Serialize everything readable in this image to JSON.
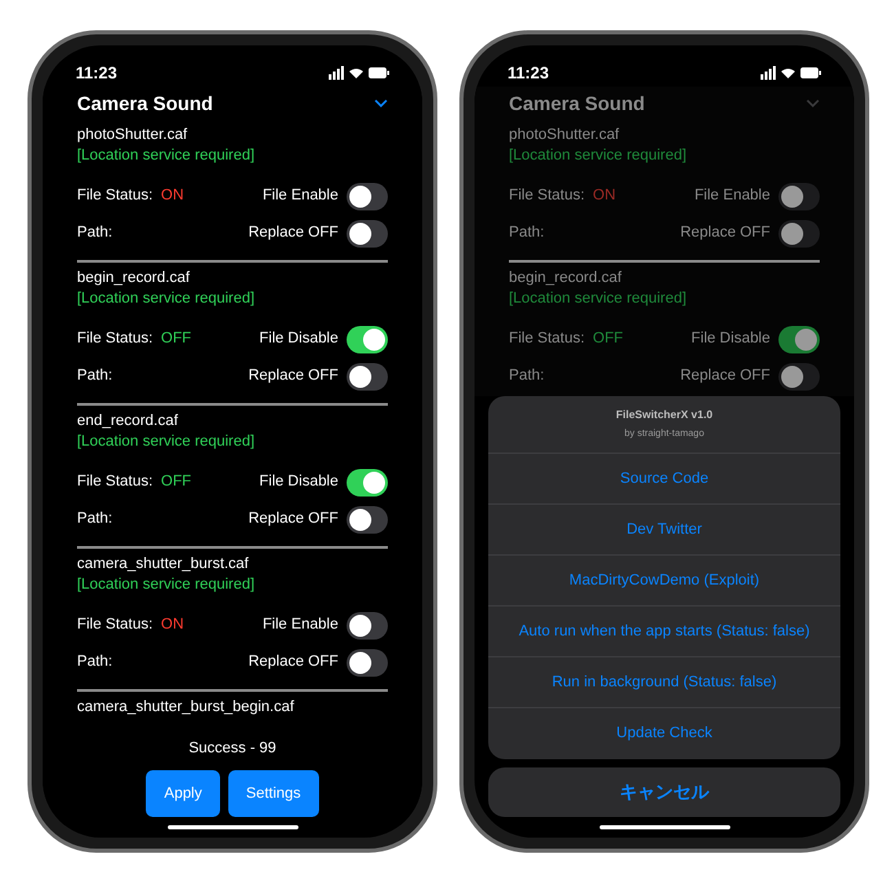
{
  "phones": [
    {
      "time": "11:23",
      "title": "Camera Sound",
      "dimmed": false,
      "files": [
        {
          "name": "photoShutter.caf",
          "note": "[Location service required]",
          "status_label": "File Status:",
          "status": "ON",
          "color": "#ff3b30",
          "enable_label": "File Enable",
          "enable_on": false,
          "path_label": "Path:",
          "replace_label": "Replace OFF",
          "replace_on": false
        },
        {
          "name": "begin_record.caf",
          "note": "[Location service required]",
          "status_label": "File Status:",
          "status": "OFF",
          "color": "#30d158",
          "enable_label": "File Disable",
          "enable_on": true,
          "path_label": "Path:",
          "replace_label": "Replace OFF",
          "replace_on": false
        },
        {
          "name": "end_record.caf",
          "note": "[Location service required]",
          "status_label": "File Status:",
          "status": "OFF",
          "color": "#30d158",
          "enable_label": "File Disable",
          "enable_on": true,
          "path_label": "Path:",
          "replace_label": "Replace OFF",
          "replace_on": false
        },
        {
          "name": "camera_shutter_burst.caf",
          "note": "[Location service required]",
          "status_label": "File Status:",
          "status": "ON",
          "color": "#ff3b30",
          "enable_label": "File Enable",
          "enable_on": false,
          "path_label": "Path:",
          "replace_label": "Replace OFF",
          "replace_on": false
        }
      ],
      "next_file": "camera_shutter_burst_begin.caf",
      "message": "Success - 99",
      "buttons": [
        "Apply",
        "Settings"
      ]
    },
    {
      "time": "11:23",
      "title": "Camera Sound",
      "dimmed": true,
      "files": [
        {
          "name": "photoShutter.caf",
          "note": "[Location service required]",
          "status_label": "File Status:",
          "status": "ON",
          "color": "#9b2a25",
          "enable_label": "File Enable",
          "enable_on": false,
          "path_label": "Path:",
          "replace_label": "Replace OFF",
          "replace_on": false
        },
        {
          "name": "begin_record.caf",
          "note": "[Location service required]",
          "status_label": "File Status:",
          "status": "OFF",
          "color": "#1f8a3b",
          "enable_label": "File Disable",
          "enable_on": true,
          "path_label": "Path:",
          "replace_label": "Replace OFF",
          "replace_on": false
        }
      ],
      "sheet": {
        "title": "FileSwitcherX v1.0",
        "subtitle": "by straight-tamago",
        "actions": [
          "Source Code",
          "Dev Twitter",
          "MacDirtyCowDemo (Exploit)",
          "Auto run when the app starts (Status: false)",
          "Run in background (Status: false)",
          "Update Check"
        ],
        "cancel": "キャンセル"
      }
    }
  ]
}
